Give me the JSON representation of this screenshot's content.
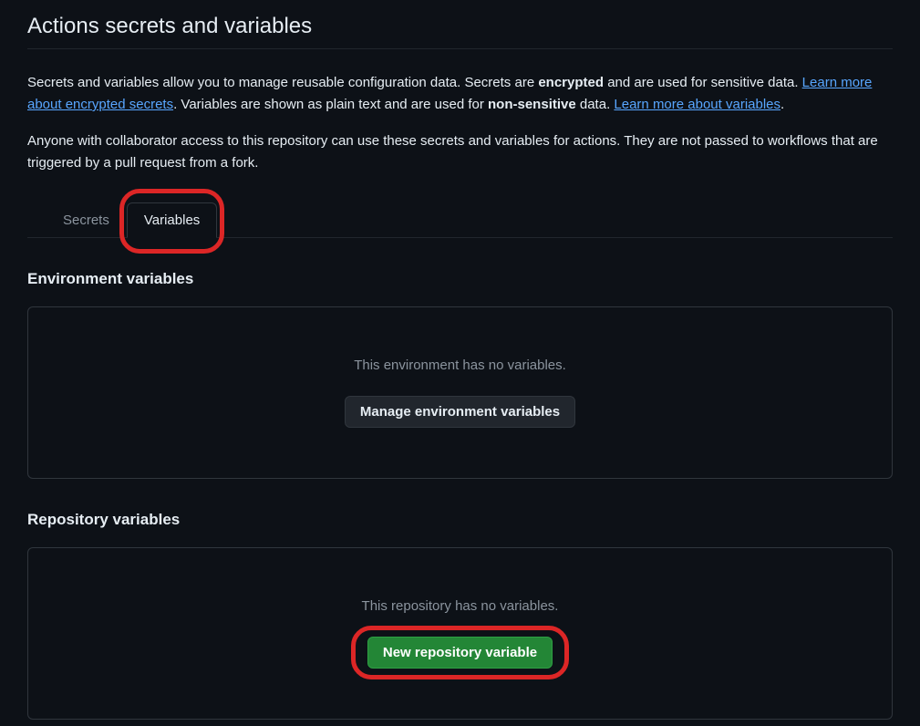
{
  "header": {
    "title": "Actions secrets and variables"
  },
  "description": {
    "intro_text_1": "Secrets and variables allow you to manage reusable configuration data. Secrets are ",
    "encrypted_bold": "encrypted",
    "intro_text_2": " and are used for sensitive data. ",
    "link_secrets": "Learn more about encrypted secrets",
    "intro_text_3": ". Variables are shown as plain text and are used for ",
    "non_sensitive_bold": "non-sensitive",
    "intro_text_4": " data. ",
    "link_variables": "Learn more about variables",
    "intro_text_5": ".",
    "access_note": "Anyone with collaborator access to this repository can use these secrets and variables for actions. They are not passed to workflows that are triggered by a pull request from a fork."
  },
  "tabs": {
    "secrets_label": "Secrets",
    "variables_label": "Variables"
  },
  "environment_section": {
    "heading": "Environment variables",
    "empty_text": "This environment has no variables.",
    "button_label": "Manage environment variables"
  },
  "repository_section": {
    "heading": "Repository variables",
    "empty_text": "This repository has no variables.",
    "button_label": "New repository variable"
  }
}
